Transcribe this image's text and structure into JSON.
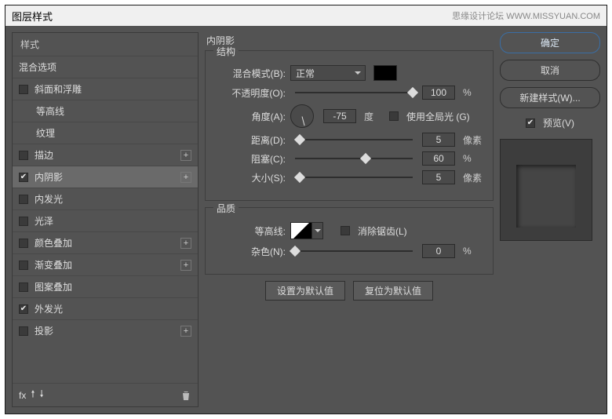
{
  "window": {
    "title": "图层样式",
    "watermark": "思缘设计论坛  WWW.MISSYUAN.COM"
  },
  "sidebar": {
    "header": "样式",
    "blendHeader": "混合选项",
    "items": [
      {
        "label": "斜面和浮雕",
        "checked": false,
        "plus": false,
        "indent": false
      },
      {
        "label": "等高线",
        "checked": false,
        "plus": false,
        "indent": true,
        "nocb": true
      },
      {
        "label": "纹理",
        "checked": false,
        "plus": false,
        "indent": true,
        "nocb": true
      },
      {
        "label": "描边",
        "checked": false,
        "plus": true,
        "indent": false
      },
      {
        "label": "内阴影",
        "checked": true,
        "plus": true,
        "indent": false,
        "selected": true
      },
      {
        "label": "内发光",
        "checked": false,
        "plus": false,
        "indent": false
      },
      {
        "label": "光泽",
        "checked": false,
        "plus": false,
        "indent": false
      },
      {
        "label": "颜色叠加",
        "checked": false,
        "plus": true,
        "indent": false
      },
      {
        "label": "渐变叠加",
        "checked": false,
        "plus": true,
        "indent": false
      },
      {
        "label": "图案叠加",
        "checked": false,
        "plus": false,
        "indent": false
      },
      {
        "label": "外发光",
        "checked": true,
        "plus": false,
        "indent": false
      },
      {
        "label": "投影",
        "checked": false,
        "plus": true,
        "indent": false
      }
    ],
    "footer": {
      "fx": "fx",
      "trash": "🗑"
    }
  },
  "panel": {
    "title": "内阴影",
    "structure": {
      "legend": "结构",
      "blendModeLabel": "混合模式(B):",
      "blendModeValue": "正常",
      "opacityLabel": "不透明度(O):",
      "opacityValue": "100",
      "opacityUnit": "%",
      "angleLabel": "角度(A):",
      "angleValue": "-75",
      "angleUnit": "度",
      "globalLightLabel": "使用全局光 (G)",
      "globalLightChecked": false,
      "distanceLabel": "距离(D):",
      "distanceValue": "5",
      "distanceUnit": "像素",
      "chokeLabel": "阻塞(C):",
      "chokeValue": "60",
      "chokeUnit": "%",
      "sizeLabel": "大小(S):",
      "sizeValue": "5",
      "sizeUnit": "像素"
    },
    "quality": {
      "legend": "品质",
      "contourLabel": "等高线:",
      "antiAliasLabel": "消除锯齿(L)",
      "antiAliasChecked": false,
      "noiseLabel": "杂色(N):",
      "noiseValue": "0",
      "noiseUnit": "%"
    },
    "buttons": {
      "setDefault": "设置为默认值",
      "resetDefault": "复位为默认值"
    }
  },
  "right": {
    "ok": "确定",
    "cancel": "取消",
    "newStyle": "新建样式(W)...",
    "previewLabel": "预览(V)",
    "previewChecked": true
  }
}
